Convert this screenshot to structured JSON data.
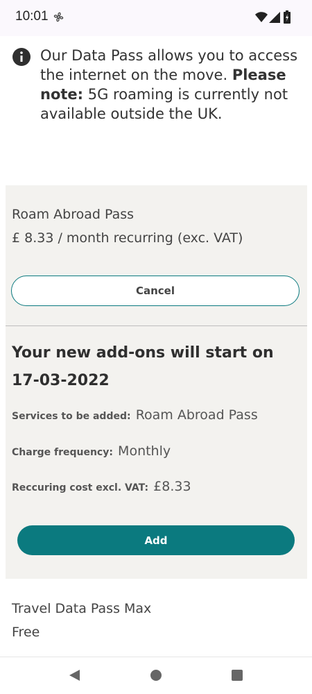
{
  "status_bar": {
    "time": "10:01",
    "icons": [
      "fan-icon",
      "wifi-icon",
      "signal-icon",
      "battery-icon"
    ]
  },
  "info": {
    "icon": "info-icon",
    "text_before": "Our Data Pass allows you to access the internet on the move. ",
    "note_label": "Please note:",
    "note_text": " 5G roaming is currently not available outside the UK."
  },
  "pass": {
    "name": "Roam Abroad Pass",
    "price": "£ 8.33 / month recurring (exc. VAT)",
    "cancel_label": "Cancel"
  },
  "addons": {
    "heading": "Your new add-ons will start on 17-03-2022",
    "services_label": "Services to be added:",
    "services_value": "Roam Abroad Pass",
    "frequency_label": "Charge frequency:",
    "frequency_value": "Monthly",
    "cost_label": "Reccuring cost excl. VAT:",
    "cost_value": "£8.33",
    "add_label": "Add"
  },
  "next_pass": {
    "name": "Travel Data Pass Max",
    "price": "Free"
  },
  "nav_bar": {
    "icons": [
      "back-icon",
      "home-icon",
      "recents-icon"
    ]
  },
  "colors": {
    "accent": "#0b7a7f",
    "card_bg": "#f3f2ef",
    "status_bg": "#fbf8fd"
  }
}
